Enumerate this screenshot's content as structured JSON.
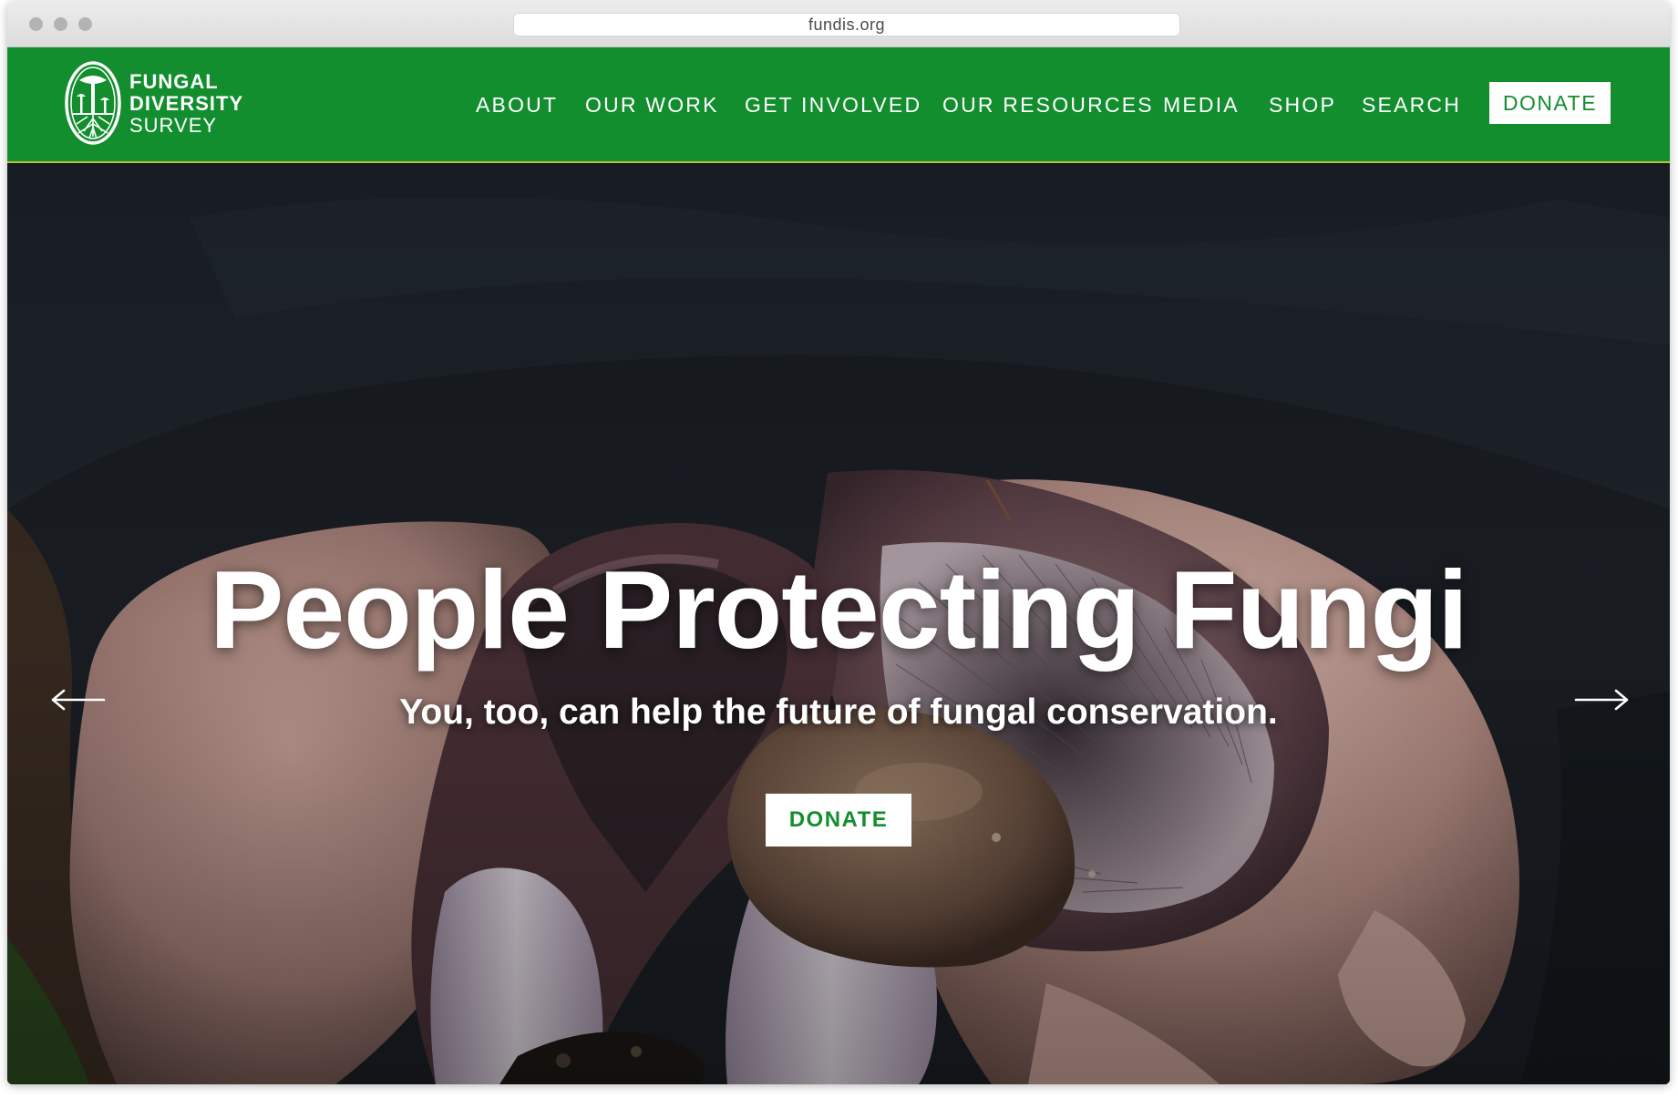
{
  "browser": {
    "url": "fundis.org"
  },
  "logo": {
    "line1": "FUNGAL",
    "line2": "DIVERSITY",
    "line3": "SURVEY"
  },
  "nav": {
    "items": [
      "ABOUT",
      "OUR WORK",
      "GET INVOLVED",
      "OUR RESOURCES",
      "MEDIA",
      "SHOP",
      "SEARCH"
    ],
    "donate_label": "DONATE"
  },
  "hero": {
    "headline": "People Protecting Fungi",
    "subheadline": "You, too, can help the future of fungal conservation.",
    "donate_label": "DONATE",
    "prev_icon": "arrow-left-icon",
    "next_icon": "arrow-right-icon"
  },
  "colors": {
    "brand_green": "#138e2e",
    "accent_line": "#b8c437",
    "white": "#ffffff"
  }
}
